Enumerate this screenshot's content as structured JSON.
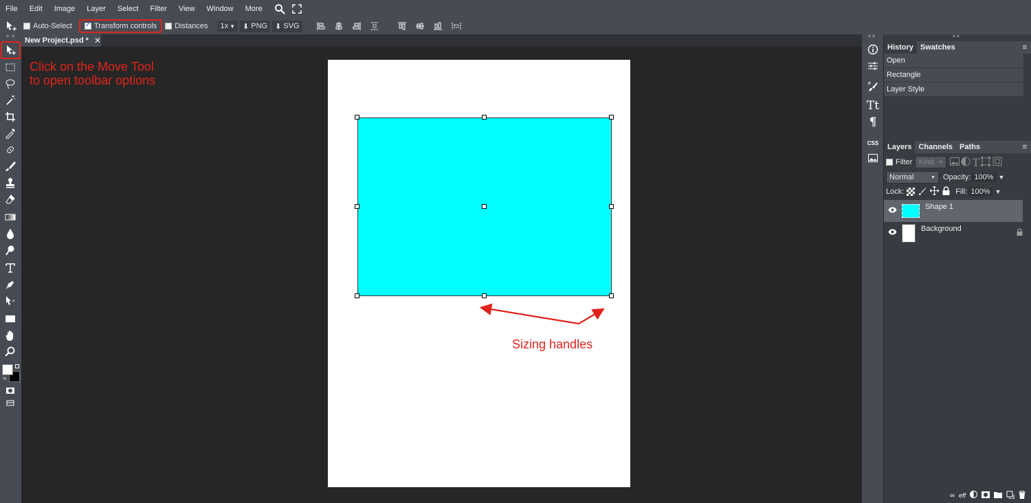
{
  "menubar": {
    "items": [
      "File",
      "Edit",
      "Image",
      "Layer",
      "Select",
      "Filter",
      "View",
      "Window",
      "More"
    ]
  },
  "options": {
    "auto_select": "Auto-Select",
    "transform_controls": "Transform controls",
    "distances": "Distances",
    "zoom": "1x",
    "png": "PNG",
    "svg": "SVG"
  },
  "document": {
    "tab_title": "New Project.psd *",
    "shape_color": "#00ffff"
  },
  "annotations": {
    "move_tool_line1": "Click on the Move Tool",
    "move_tool_line2": "to open toolbar options",
    "handles": "Sizing handles",
    "color": "#e0241b"
  },
  "history_panel": {
    "tabs": [
      "History",
      "Swatches"
    ],
    "items": [
      "Open",
      "Rectangle",
      "Layer Style"
    ]
  },
  "layers_panel": {
    "tabs": [
      "Layers",
      "Channels",
      "Paths"
    ],
    "filter_label": "Filter",
    "kind_placeholder": "Kind",
    "blend_mode": "Normal",
    "opacity_label": "Opacity:",
    "opacity_value": "100%",
    "lock_label": "Lock:",
    "fill_label": "Fill:",
    "fill_value": "100%",
    "layers": [
      {
        "name": "Shape 1"
      },
      {
        "name": "Background"
      }
    ]
  },
  "icons": {
    "collapse_left": "> <",
    "expand": "< >",
    "css_label": "CSS",
    "bottom_eff": "eff"
  }
}
